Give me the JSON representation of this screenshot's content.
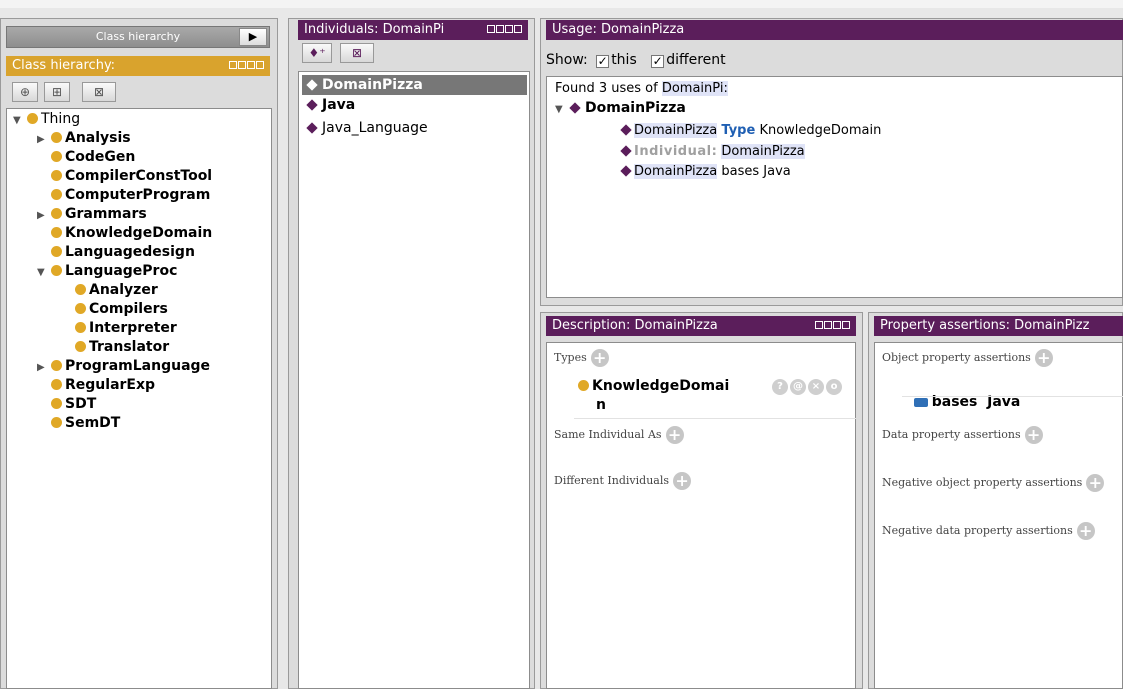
{
  "class_panel": {
    "tab_label": "Class hierarchy",
    "tab_arrow": "▶",
    "title": "Class hierarchy:",
    "tool_icons": [
      "add-subclass-icon",
      "add-sibling-icon",
      "delete-class-icon"
    ],
    "tree": [
      {
        "label": "Thing",
        "expander": "▼",
        "bold": false
      },
      {
        "label": "Analysis",
        "expander": "▶",
        "bold": true
      },
      {
        "label": "CodeGen",
        "expander": "",
        "bold": true
      },
      {
        "label": "CompilerConstTool",
        "expander": "",
        "bold": true
      },
      {
        "label": "ComputerProgram",
        "expander": "",
        "bold": true
      },
      {
        "label": "Grammars",
        "expander": "▶",
        "bold": true
      },
      {
        "label": "KnowledgeDomain",
        "expander": "",
        "bold": true
      },
      {
        "label": "Languagedesign",
        "expander": "",
        "bold": true
      },
      {
        "label": "LanguageProc",
        "expander": "▼",
        "bold": true
      },
      {
        "label": "Analyzer",
        "expander": "",
        "bold": true
      },
      {
        "label": "Compilers",
        "expander": "",
        "bold": true
      },
      {
        "label": "Interpreter",
        "expander": "",
        "bold": true
      },
      {
        "label": "Translator",
        "expander": "",
        "bold": true
      },
      {
        "label": "ProgramLanguage",
        "expander": "▶",
        "bold": true
      },
      {
        "label": "RegularExp",
        "expander": "",
        "bold": true
      },
      {
        "label": "SDT",
        "expander": "",
        "bold": true
      },
      {
        "label": "SemDT",
        "expander": "",
        "bold": true
      }
    ]
  },
  "individuals_panel": {
    "title": "Individuals: DomainPi",
    "tool_icons": [
      "add-individual-icon",
      "delete-individual-icon"
    ],
    "items": [
      "DomainPizza",
      "Java",
      "Java_Language"
    ],
    "selected": "DomainPizza"
  },
  "usage_panel": {
    "title": "Usage: DomainPizza",
    "show_label": "Show:",
    "checkbox_this": "this",
    "checkbox_different": "different",
    "found_text": "Found 3 uses of",
    "found_entity": "DomainPi:",
    "root": "DomainPizza",
    "row1": {
      "subject": "DomainPizza",
      "keyword": "Type",
      "object": "KnowledgeDomain"
    },
    "row2": {
      "keyword": "Individual:",
      "object": "DomainPizza"
    },
    "row3": {
      "subject": "DomainPizza",
      "rest": "bases Java"
    }
  },
  "description_panel": {
    "title": "Description: DomainPizza",
    "types_label": "Types",
    "type_value_line1": "KnowledgeDomai",
    "type_value_line2": "n",
    "type_buttons": [
      "?",
      "@",
      "×",
      "o"
    ],
    "same_label": "Same Individual As",
    "different_label": "Different Individuals"
  },
  "property_panel": {
    "title": "Property assertions: DomainPizz",
    "object_label": "Object property assertions",
    "object_value": "bases  Java",
    "data_label": "Data property assertions",
    "neg_object_label": "Negative object property assertions",
    "neg_data_label": "Negative data property assertions"
  },
  "colors": {
    "purple": "#5b1e5b",
    "gold": "#d9a32d",
    "class_dot": "#e0a826",
    "keyword_blue": "#1f5fb3"
  }
}
